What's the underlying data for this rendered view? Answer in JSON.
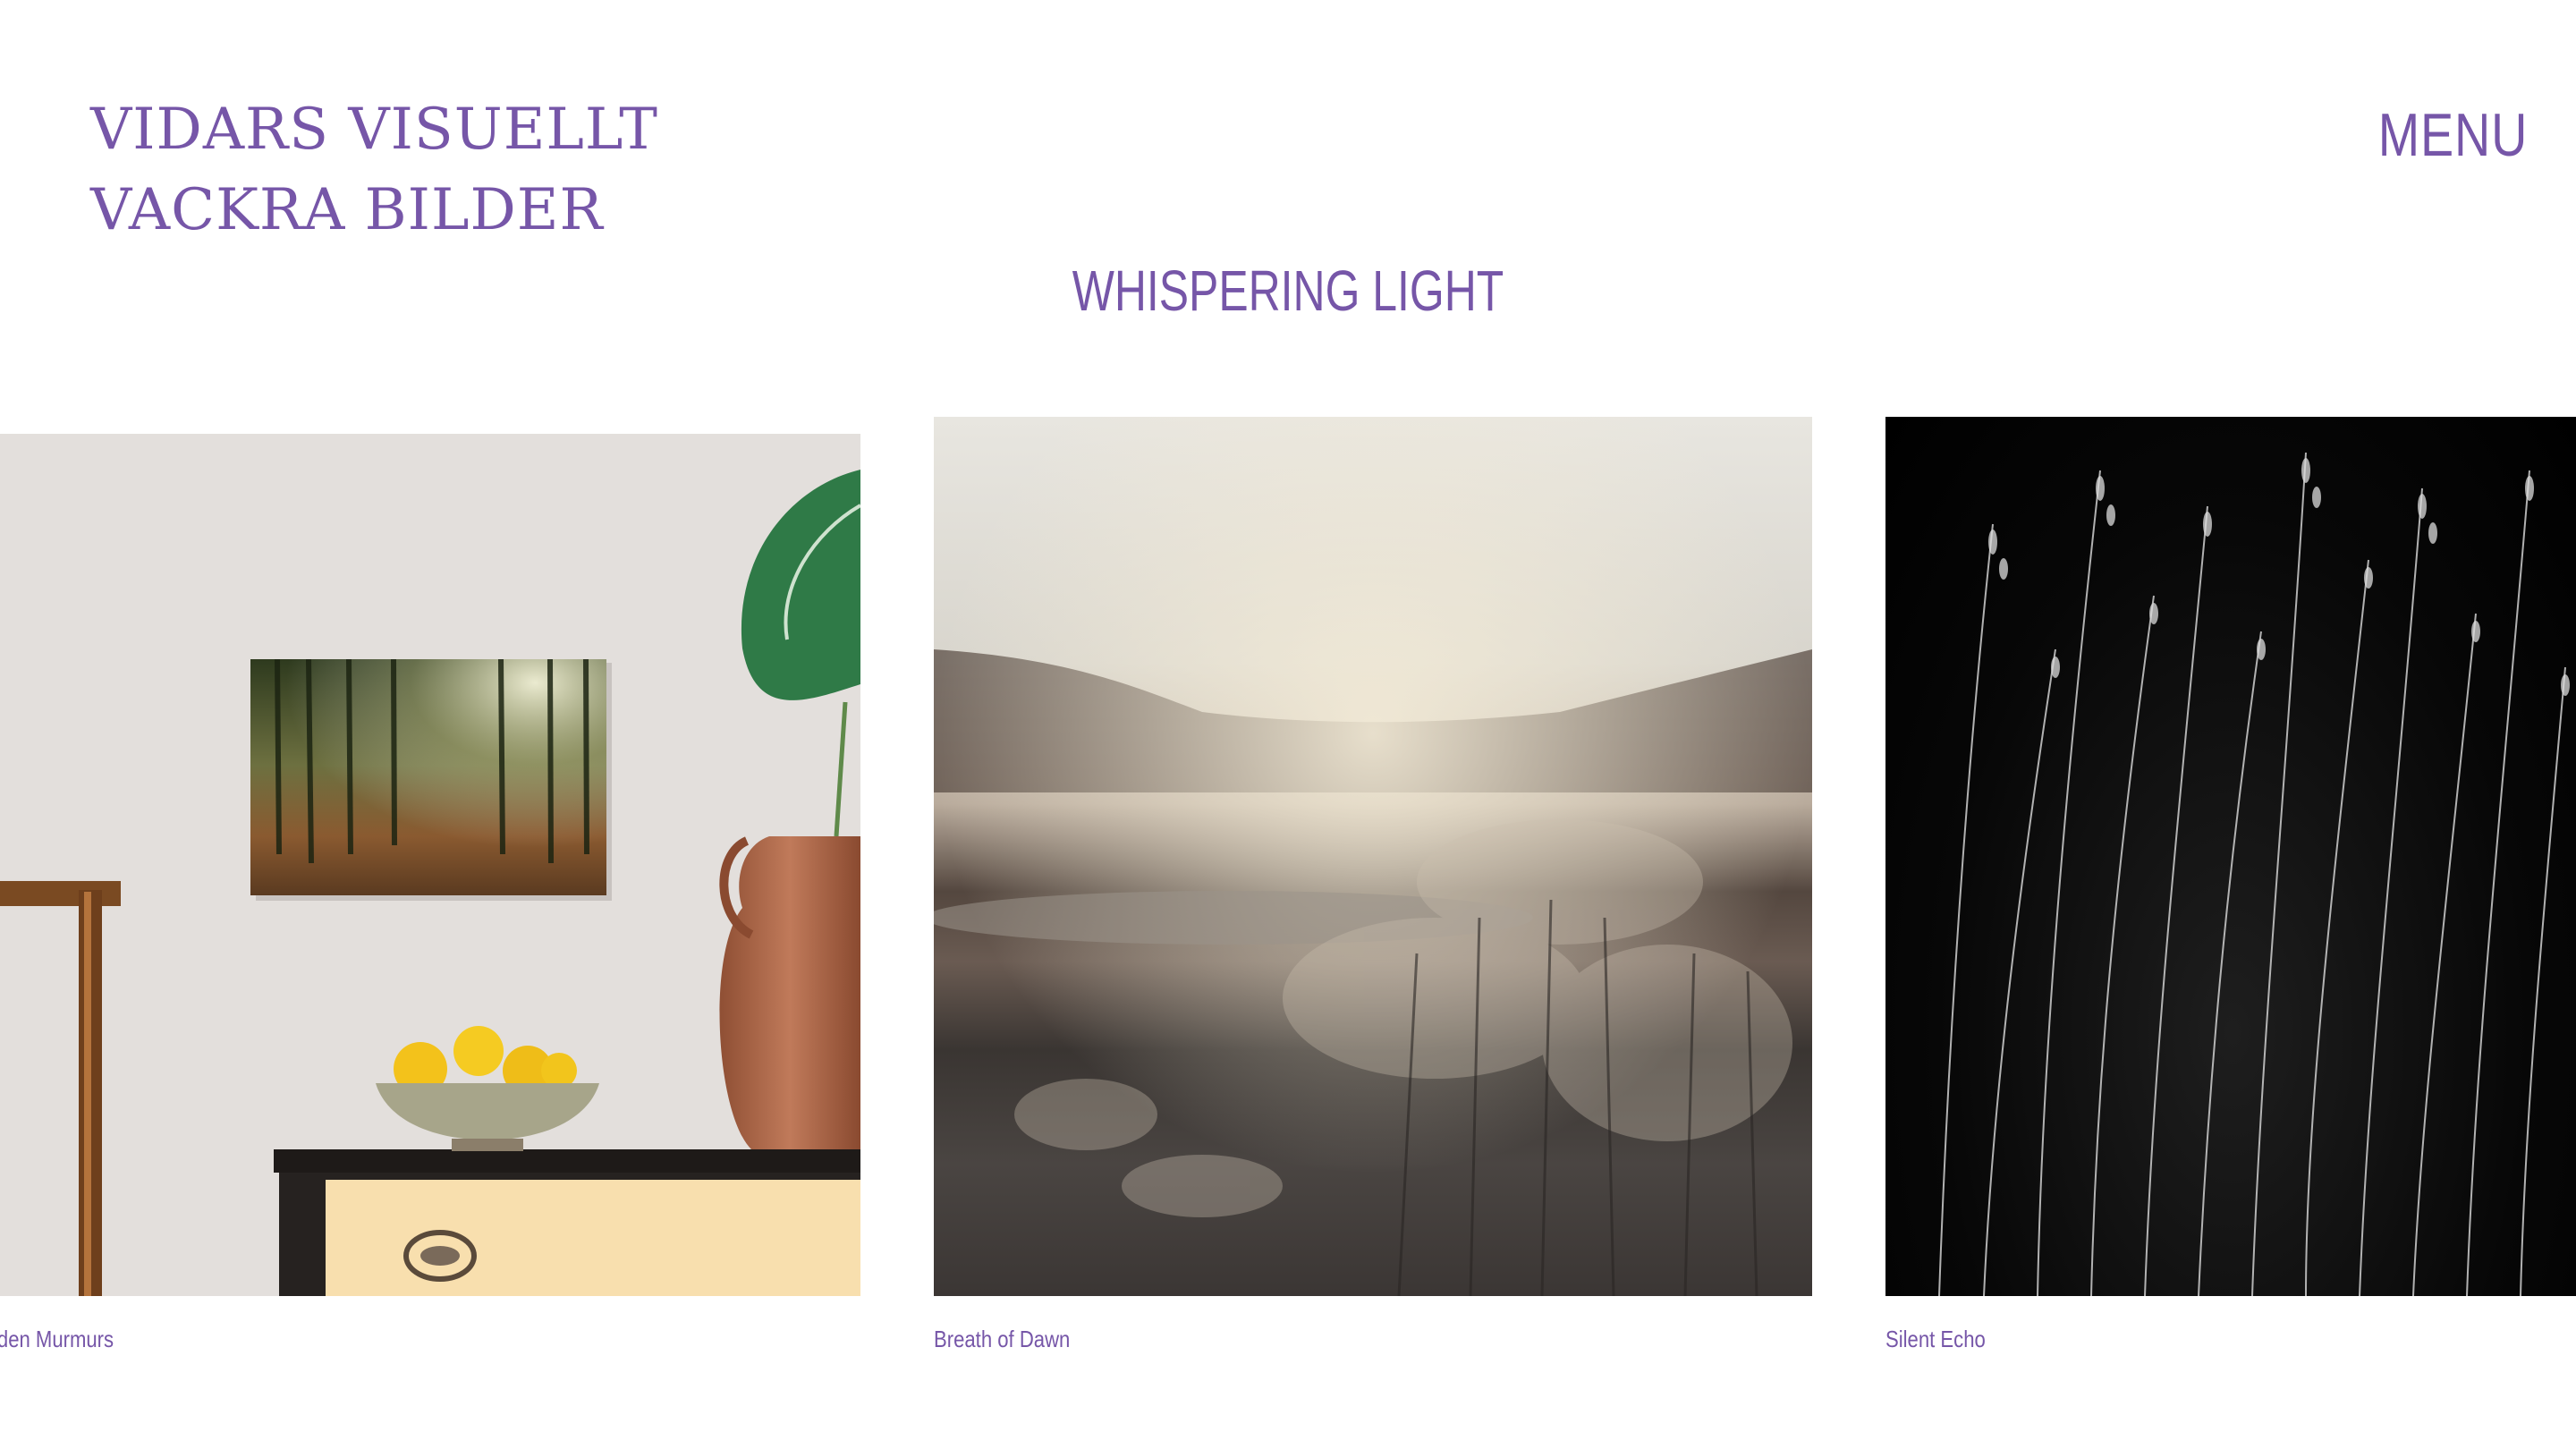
{
  "site": {
    "logo_line1": "VIDARS VISUELLT",
    "logo_line2": "VACKRA BILDER",
    "menu_label": "MENU"
  },
  "gallery": {
    "title": "WHISPERING LIGHT",
    "items": [
      {
        "caption": "lden Murmurs"
      },
      {
        "caption": "Breath of Dawn"
      },
      {
        "caption": "Silent Echo"
      }
    ]
  },
  "colors": {
    "accent": "#7656a8",
    "background": "#ffffff"
  }
}
